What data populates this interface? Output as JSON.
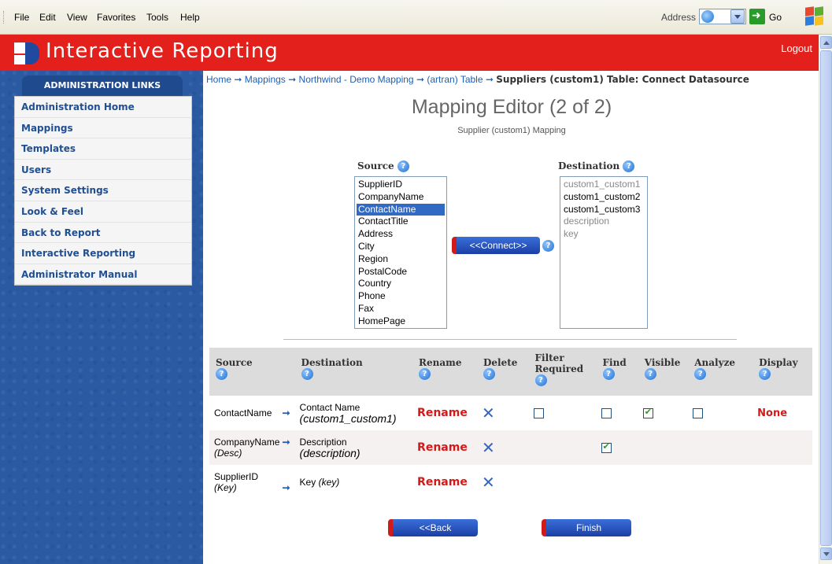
{
  "browser": {
    "menu": [
      "File",
      "Edit",
      "View",
      "Favorites",
      "Tools",
      "Help"
    ],
    "address_label": "Address",
    "go_label": "Go"
  },
  "header": {
    "title": "Interactive Reporting",
    "logout": "Logout"
  },
  "sidebar": {
    "heading": "ADMINISTRATION LINKS",
    "items": [
      "Administration Home",
      "Mappings",
      "Templates",
      "Users",
      "System Settings",
      "Look & Feel",
      "Back to Report",
      "Interactive Reporting",
      "Administrator Manual"
    ]
  },
  "breadcrumb": {
    "links": [
      "Home",
      "Mappings",
      "Northwind - Demo Mapping",
      "(artran) Table"
    ],
    "current": "Suppliers (custom1) Table: Connect Datasource"
  },
  "page": {
    "title": "Mapping Editor (2 of 2)",
    "subtitle": "Supplier (custom1) Mapping"
  },
  "source": {
    "label": "Source",
    "options": [
      "SupplierID",
      "CompanyName",
      "ContactName",
      "ContactTitle",
      "Address",
      "City",
      "Region",
      "PostalCode",
      "Country",
      "Phone",
      "Fax",
      "HomePage"
    ],
    "selected": "ContactName"
  },
  "destination": {
    "label": "Destination",
    "options": [
      "custom1_custom1",
      "custom1_custom2",
      "custom1_custom3",
      "description",
      "key"
    ],
    "dimmed": [
      "custom1_custom1",
      "description",
      "key"
    ]
  },
  "buttons": {
    "connect": "<<Connect>>",
    "back": "<<Back",
    "finish": "Finish"
  },
  "table": {
    "headers": {
      "source": "Source",
      "destination": "Destination",
      "rename": "Rename",
      "delete": "Delete",
      "filter_required": "Filter Required",
      "find": "Find",
      "visible": "Visible",
      "analyze": "Analyze",
      "display": "Display"
    },
    "rows": [
      {
        "source": "ContactName",
        "source_tag": "",
        "dest": "Contact Name",
        "dest_tag": "(custom1_custom1)",
        "rename": "Rename",
        "filter": false,
        "find": false,
        "visible": true,
        "analyze": false,
        "display": "None"
      },
      {
        "source": "CompanyName",
        "source_tag": "(Desc)",
        "dest": "Description",
        "dest_tag": "(description)",
        "rename": "Rename",
        "find": true
      },
      {
        "source": "SupplierID",
        "source_tag": "(Key)",
        "dest": "Key",
        "dest_tag": "(key)",
        "rename": "Rename"
      }
    ]
  }
}
